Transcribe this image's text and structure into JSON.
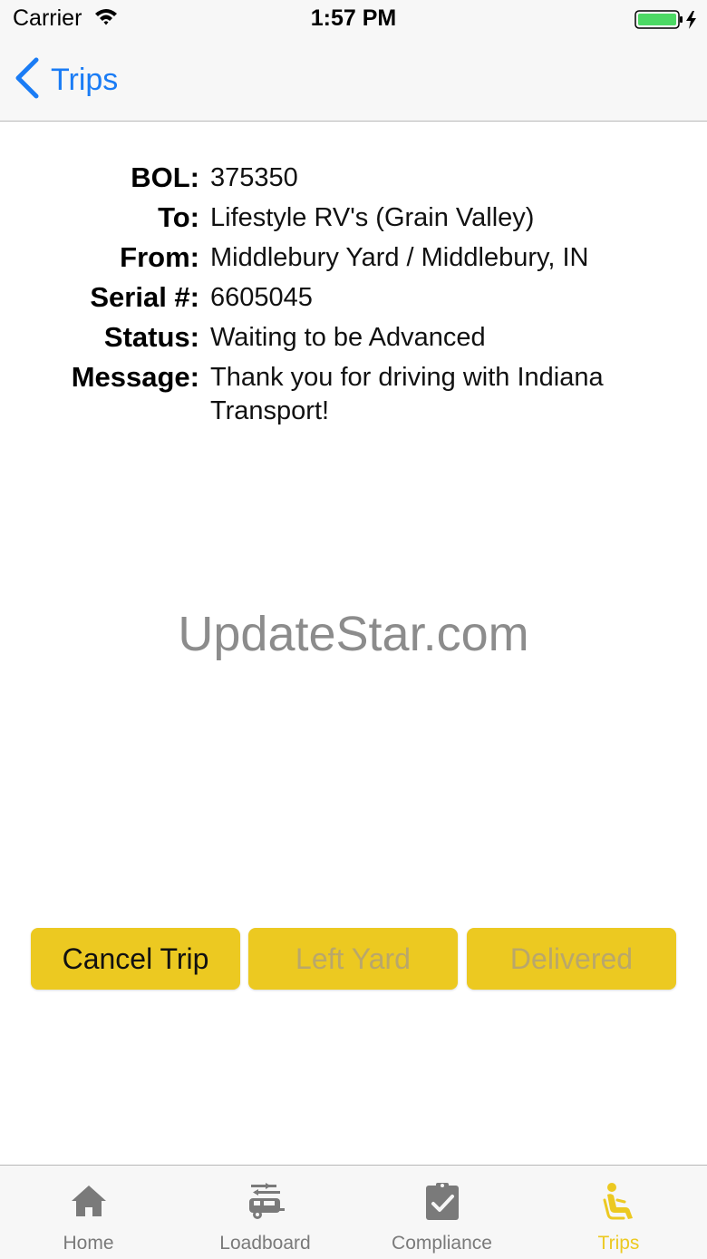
{
  "status_bar": {
    "carrier": "Carrier",
    "time": "1:57 PM",
    "battery_color": "#4cd964"
  },
  "nav": {
    "back_label": "Trips",
    "accent_color": "#1a7cf5"
  },
  "details": [
    {
      "label": "BOL:",
      "value": "375350"
    },
    {
      "label": "To:",
      "value": "Lifestyle RV's (Grain Valley)"
    },
    {
      "label": "From:",
      "value": "Middlebury Yard / Middlebury, IN"
    },
    {
      "label": "Serial #:",
      "value": "6605045"
    },
    {
      "label": "Status:",
      "value": "Waiting to be Advanced"
    },
    {
      "label": "Message:",
      "value": "Thank you for driving with Indiana Transport!"
    }
  ],
  "watermark": "UpdateStar.com",
  "actions": {
    "cancel_trip": "Cancel Trip",
    "left_yard": "Left Yard",
    "delivered": "Delivered",
    "button_color": "#ecc921"
  },
  "tabs": [
    {
      "label": "Home",
      "icon": "home-icon"
    },
    {
      "label": "Loadboard",
      "icon": "rv-icon"
    },
    {
      "label": "Compliance",
      "icon": "clipboard-check-icon"
    },
    {
      "label": "Trips",
      "icon": "seated-person-icon",
      "active": true
    }
  ]
}
